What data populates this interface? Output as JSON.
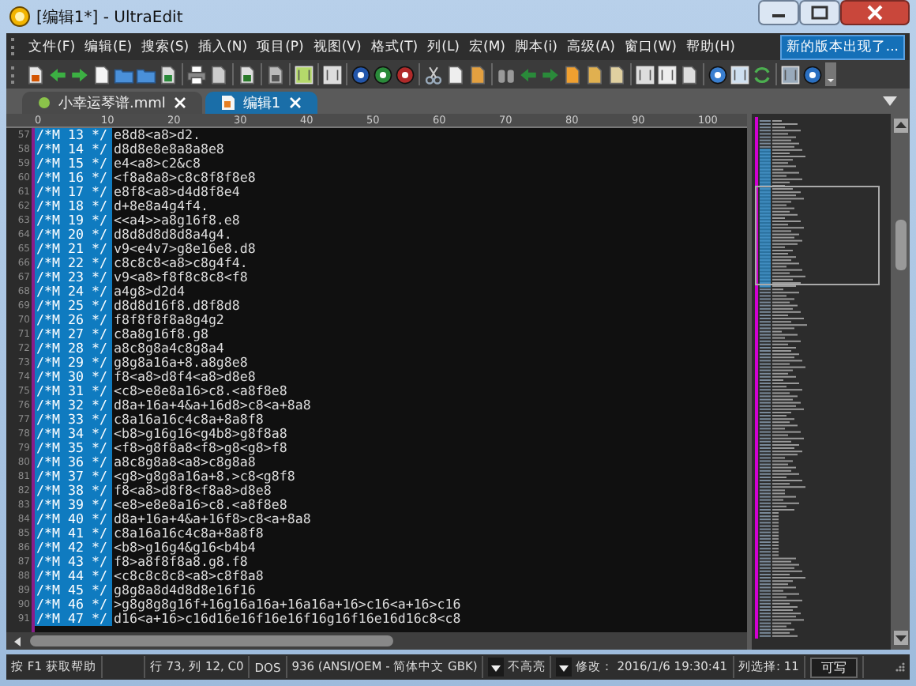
{
  "window": {
    "title": "[编辑1*] - UltraEdit"
  },
  "menu": [
    {
      "label": "文件(F)"
    },
    {
      "label": "编辑(E)"
    },
    {
      "label": "搜索(S)"
    },
    {
      "label": "插入(N)"
    },
    {
      "label": "项目(P)"
    },
    {
      "label": "视图(V)"
    },
    {
      "label": "格式(T)"
    },
    {
      "label": "列(L)"
    },
    {
      "label": "宏(M)"
    },
    {
      "label": "脚本(i)"
    },
    {
      "label": "高级(A)"
    },
    {
      "label": "窗口(W)"
    },
    {
      "label": "帮助(H)"
    }
  ],
  "update_notice": "新的版本出现了...",
  "tabs": [
    {
      "label": "小幸运琴谱.mml",
      "selected": false,
      "kind": "dot"
    },
    {
      "label": "编辑1",
      "selected": true,
      "kind": "doc"
    }
  ],
  "ruler": [
    "0",
    "10",
    "20",
    "30",
    "40",
    "50",
    "60",
    "70",
    "80",
    "90",
    "100"
  ],
  "lines": [
    {
      "number": "57",
      "marker": "/*M 13 */",
      "code": "e8d8<a8>d2."
    },
    {
      "number": "58",
      "marker": "/*M 14 */",
      "code": "d8d8e8e8a8a8e8"
    },
    {
      "number": "59",
      "marker": "/*M 15 */",
      "code": "e4<a8>c2&c8"
    },
    {
      "number": "60",
      "marker": "/*M 16 */",
      "code": "<f8a8a8>c8c8f8f8e8"
    },
    {
      "number": "61",
      "marker": "/*M 17 */",
      "code": "e8f8<a8>d4d8f8e4"
    },
    {
      "number": "62",
      "marker": "/*M 18 */",
      "code": "d+8e8a4g4f4."
    },
    {
      "number": "63",
      "marker": "/*M 19 */",
      "code": "<<a4>>a8g16f8.e8"
    },
    {
      "number": "64",
      "marker": "/*M 20 */",
      "code": "d8d8d8d8d8a4g4."
    },
    {
      "number": "65",
      "marker": "/*M 21 */",
      "code": "v9<e4v7>g8e16e8.d8"
    },
    {
      "number": "66",
      "marker": "/*M 22 */",
      "code": "c8c8c8<a8>c8g4f4."
    },
    {
      "number": "67",
      "marker": "/*M 23 */",
      "code": "v9<a8>f8f8c8c8<f8"
    },
    {
      "number": "68",
      "marker": "/*M 24 */",
      "code": "a4g8>d2d4"
    },
    {
      "number": "69",
      "marker": "/*M 25 */",
      "code": "d8d8d16f8.d8f8d8"
    },
    {
      "number": "70",
      "marker": "/*M 26 */",
      "code": "f8f8f8f8a8g4g2"
    },
    {
      "number": "71",
      "marker": "/*M 27 */",
      "code": "c8a8g16f8.g8"
    },
    {
      "number": "72",
      "marker": "/*M 28 */",
      "code": "a8c8g8a4c8g8a4"
    },
    {
      "number": "73",
      "marker": "/*M 29 */",
      "code": "g8g8a16a+8.a8g8e8"
    },
    {
      "number": "74",
      "marker": "/*M 30 */",
      "code": "f8<a8>d8f4<a8>d8e8"
    },
    {
      "number": "75",
      "marker": "/*M 31 */",
      "code": "<c8>e8e8a16>c8.<a8f8e8"
    },
    {
      "number": "76",
      "marker": "/*M 32 */",
      "code": "d8a+16a+4&a+16d8>c8<a+8a8"
    },
    {
      "number": "77",
      "marker": "/*M 33 */",
      "code": "c8a16a16c4c8a+8a8f8"
    },
    {
      "number": "78",
      "marker": "/*M 34 */",
      "code": "<b8>g16g16<g4b8>g8f8a8"
    },
    {
      "number": "79",
      "marker": "/*M 35 */",
      "code": "<f8>g8f8a8<f8>g8<g8>f8"
    },
    {
      "number": "80",
      "marker": "/*M 36 */",
      "code": "a8c8g8a8<a8>c8g8a8"
    },
    {
      "number": "81",
      "marker": "/*M 37 */",
      "code": "<g8>g8g8a16a+8.>c8<g8f8"
    },
    {
      "number": "82",
      "marker": "/*M 38 */",
      "code": "f8<a8>d8f8<f8a8>d8e8"
    },
    {
      "number": "83",
      "marker": "/*M 39 */",
      "code": "<e8>e8e8a16>c8.<a8f8e8"
    },
    {
      "number": "84",
      "marker": "/*M 40 */",
      "code": "d8a+16a+4&a+16f8>c8<a+8a8"
    },
    {
      "number": "85",
      "marker": "/*M 41 */",
      "code": "c8a16a16c4c8a+8a8f8"
    },
    {
      "number": "86",
      "marker": "/*M 42 */",
      "code": "<b8>g16g4&g16<b4b4"
    },
    {
      "number": "87",
      "marker": "/*M 43 */",
      "code": "f8>a8f8f8a8.g8.f8"
    },
    {
      "number": "88",
      "marker": "/*M 44 */",
      "code": "<c8c8c8c8<a8>c8f8a8"
    },
    {
      "number": "89",
      "marker": "/*M 45 */",
      "code": "g8g8a8d4d8d8e16f16"
    },
    {
      "number": "90",
      "marker": "/*M 46 */",
      "code": ">g8g8g8g16f+16g16a16a+16a16a+16>c16<a+16>c16"
    },
    {
      "number": "91",
      "marker": "/*M 47 */",
      "code": "d16<a+16>c16d16e16f16e16f16g16f16e16d16c8<c8"
    }
  ],
  "status_bar": [
    {
      "text": "按 F1 获取帮助",
      "kind": "text"
    },
    {
      "kind": "blank"
    },
    {
      "text": "行 73, 列 12, C0",
      "kind": "text"
    },
    {
      "text": "DOS",
      "kind": "text"
    },
    {
      "text": "936   (ANSI/OEM - 简体中文 GBK)",
      "kind": "text"
    },
    {
      "text": "不高亮",
      "kind": "dropdown"
    },
    {
      "text": "修改： 2016/1/6 19:30:41",
      "kind": "dropdown"
    },
    {
      "text": "列选择: 11",
      "kind": "text"
    },
    {
      "text": "可写",
      "kind": "button"
    }
  ]
}
